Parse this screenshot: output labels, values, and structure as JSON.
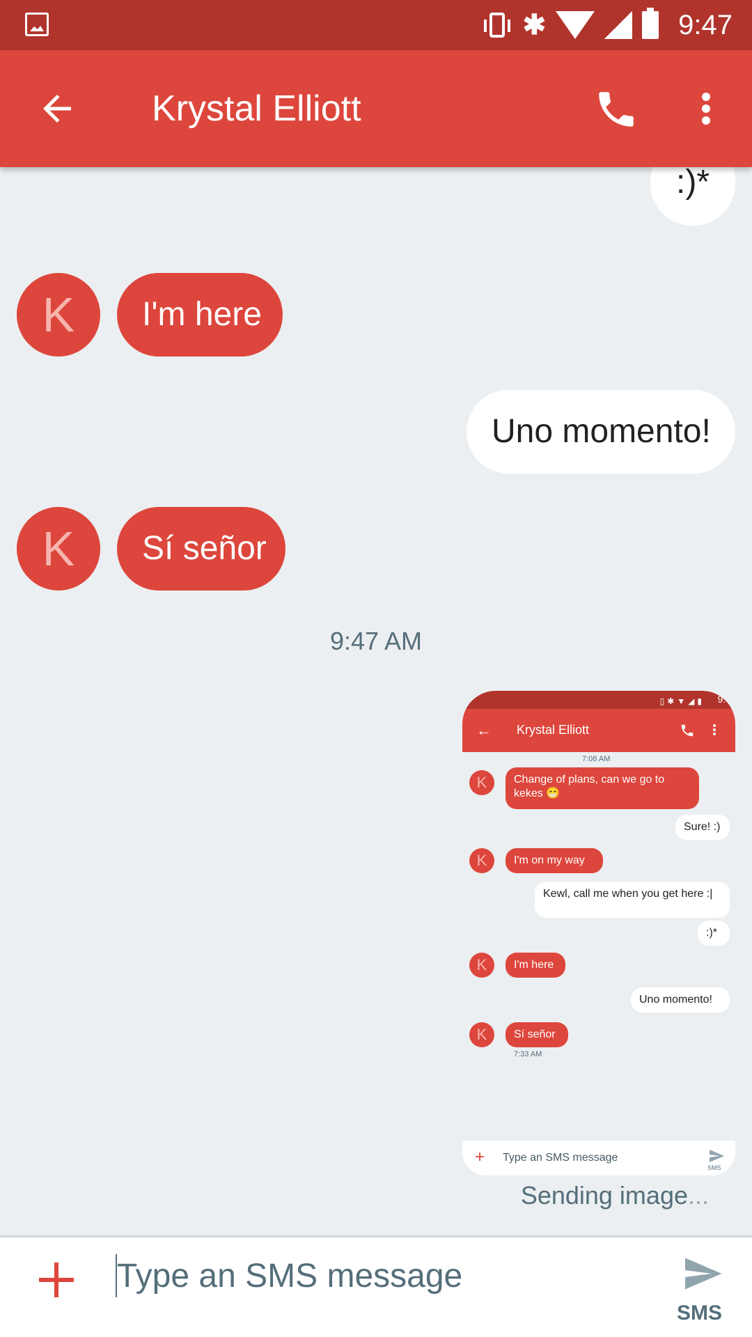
{
  "status_bar": {
    "time": "9:47"
  },
  "header": {
    "contact_name": "Krystal Elliott"
  },
  "messages": [
    {
      "dir": "out",
      "text": ":)*"
    },
    {
      "dir": "in",
      "text": "I'm here",
      "avatar": "K"
    },
    {
      "dir": "out",
      "text": "Uno momento!"
    },
    {
      "dir": "in",
      "text": "Sí señor",
      "avatar": "K"
    }
  ],
  "timestamp": "9:47 AM",
  "image_preview": {
    "status_time": "9:4",
    "title": "Krystal Elliott",
    "top_stamp": "7:08 AM",
    "messages": [
      {
        "dir": "in",
        "text": "Change of plans, can we go to kekes 😁",
        "avatar": "K"
      },
      {
        "dir": "out",
        "text": "Sure! :)"
      },
      {
        "dir": "in",
        "text": "I'm on my way",
        "avatar": "K"
      },
      {
        "dir": "out",
        "text": "Kewl, call me when you get here :|"
      },
      {
        "dir": "out",
        "text": ":)*"
      },
      {
        "dir": "in",
        "text": "I'm here",
        "avatar": "K"
      },
      {
        "dir": "out",
        "text": "Uno momento!"
      },
      {
        "dir": "in",
        "text": "Sí señor",
        "avatar": "K"
      }
    ],
    "bottom_stamp": "7:33 AM",
    "compose_placeholder": "Type an SMS message",
    "send_label": "SMS"
  },
  "sending_status": {
    "text": "Sending image",
    "ellipsis": "..."
  },
  "compose": {
    "placeholder": "Type an SMS message",
    "send_label": "SMS"
  },
  "colors": {
    "accent": "#DD463C",
    "status_bar": "#B0342C",
    "background": "#ECEFF1",
    "incoming_bubble": "#DD463C",
    "outgoing_bubble": "#FFFFFF"
  }
}
